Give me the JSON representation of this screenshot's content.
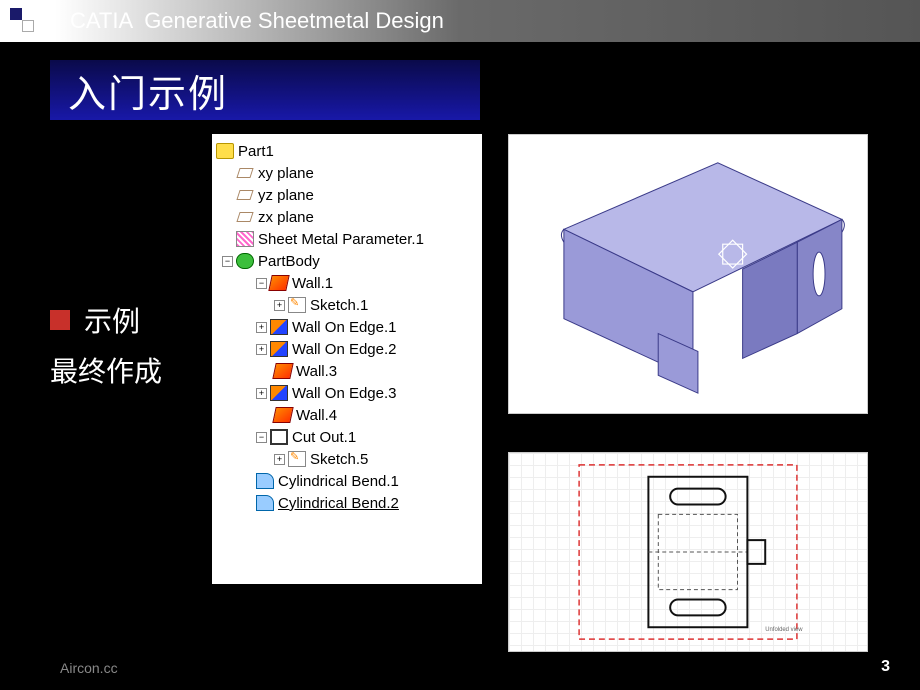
{
  "header": {
    "app": "CATIA",
    "subtitle": "Generative Sheetmetal Design"
  },
  "title": "入门示例",
  "content": {
    "bullet": "示例",
    "line2": "最终作成"
  },
  "tree": {
    "root": "Part1",
    "items": [
      {
        "label": "xy plane",
        "icon": "plane"
      },
      {
        "label": "yz plane",
        "icon": "plane"
      },
      {
        "label": "zx plane",
        "icon": "plane"
      },
      {
        "label": "Sheet Metal Parameter.1",
        "icon": "param"
      }
    ],
    "body": {
      "label": "PartBody",
      "children": [
        {
          "label": "Wall.1",
          "icon": "wall",
          "exp": "-"
        },
        {
          "label": "Sketch.1",
          "icon": "sketch",
          "indent": 3,
          "exp": "+"
        },
        {
          "label": "Wall On Edge.1",
          "icon": "walledge",
          "exp": "+"
        },
        {
          "label": "Wall On Edge.2",
          "icon": "walledge",
          "exp": "+"
        },
        {
          "label": "Wall.3",
          "icon": "wall",
          "indent": 3
        },
        {
          "label": "Wall On Edge.3",
          "icon": "walledge",
          "exp": "+"
        },
        {
          "label": "Wall.4",
          "icon": "wall",
          "indent": 3
        },
        {
          "label": "Cut Out.1",
          "icon": "cut",
          "exp": "-"
        },
        {
          "label": "Sketch.5",
          "icon": "sketch",
          "indent": 3,
          "exp": "+"
        },
        {
          "label": "Cylindrical Bend.1",
          "icon": "bend"
        },
        {
          "label": "Cylindrical Bend.2",
          "icon": "bend",
          "underline": true
        }
      ]
    }
  },
  "footer": {
    "left": "Aircon.cc",
    "page": "3"
  }
}
